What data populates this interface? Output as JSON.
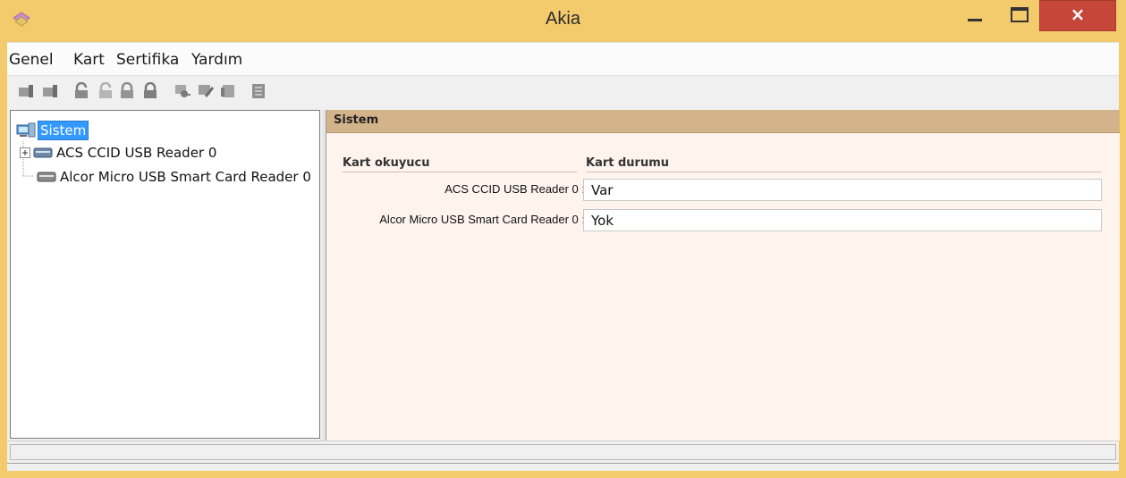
{
  "window": {
    "title": "Akia",
    "controls": {
      "minimize_icon": "minimize-icon",
      "maximize_icon": "maximize-icon",
      "close_label": "×"
    }
  },
  "menu": {
    "items": [
      {
        "label": "Genel"
      },
      {
        "label": "Kart"
      },
      {
        "label": "Sertifika"
      },
      {
        "label": "Yardım"
      }
    ]
  },
  "toolbar": {
    "icons": [
      "card-insert-icon",
      "card-remove-icon",
      "unlock-icon",
      "lock-open-icon",
      "lock-icon",
      "lock-closed-icon",
      "key-icon",
      "key-edit-icon",
      "certificate-icon",
      "export-icon"
    ]
  },
  "tree": {
    "root": {
      "label": "Sistem"
    },
    "children": [
      {
        "label": "ACS CCID USB Reader 0",
        "expander": "+"
      },
      {
        "label": "Alcor Micro USB Smart Card Reader 0",
        "expander": ""
      }
    ]
  },
  "content": {
    "header": "Sistem",
    "columns": {
      "reader": "Kart okuyucu",
      "status": "Kart durumu"
    },
    "rows": [
      {
        "reader": "ACS CCID USB Reader 0 :",
        "status": "Var"
      },
      {
        "reader": "Alcor Micro USB Smart Card Reader 0 :",
        "status": "Yok"
      }
    ]
  },
  "colors": {
    "titlebar": "#f3cb6c",
    "close_button": "#c7463a",
    "content_header": "#d3b48a",
    "content_bg": "#fff3ee",
    "selection": "#3399ff"
  }
}
